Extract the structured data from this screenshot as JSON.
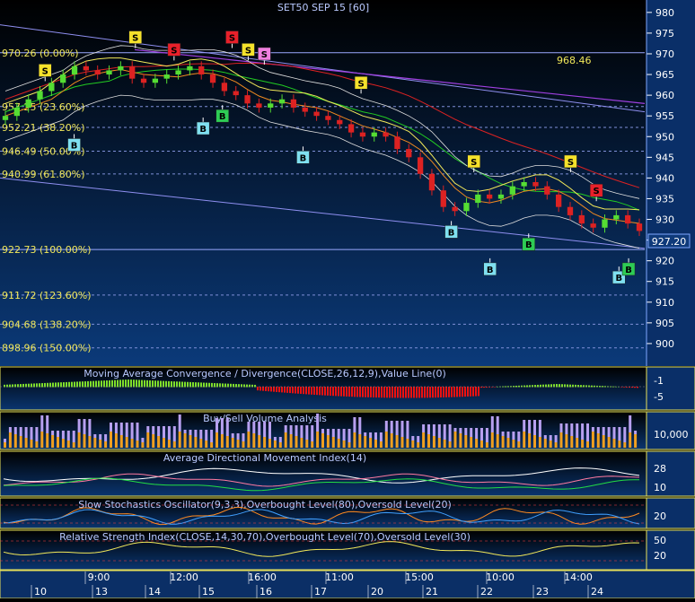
{
  "chart_data": [
    {
      "type": "candlestick",
      "title": "SET50 SEP 15   [60]",
      "y_ticks": [
        980,
        975,
        970,
        965,
        960,
        955,
        950,
        945,
        940,
        935,
        930,
        925,
        920,
        915,
        910,
        905,
        900
      ],
      "ylim": [
        895,
        983
      ],
      "last_price": "927.20",
      "annotation": "968.46",
      "close_series": [
        955,
        957,
        959,
        961,
        963,
        965,
        967,
        966,
        965,
        966,
        967,
        964,
        963,
        964,
        965,
        966,
        967,
        965,
        963,
        961,
        960,
        958,
        957,
        958,
        959,
        957,
        956,
        955,
        954,
        953,
        951,
        950,
        951,
        950,
        947,
        945,
        941,
        937,
        933,
        932,
        934,
        936,
        935,
        936,
        938,
        939,
        938,
        936,
        933,
        931,
        929,
        928,
        930,
        931,
        929,
        927.2
      ],
      "fibonacci": [
        {
          "label": "970.26 (0.00%)",
          "value": 970.26
        },
        {
          "label": "957.25 (23.60%)",
          "value": 957.25
        },
        {
          "label": "952.21 (38.20%)",
          "value": 952.21
        },
        {
          "label": "946.49 (50.00%)",
          "value": 946.49
        },
        {
          "label": "940.99 (61.80%)",
          "value": 940.99
        },
        {
          "label": "922.73 (100.00%)",
          "value": 922.73
        },
        {
          "label": "911.72 (123.60%)",
          "value": 911.72
        },
        {
          "label": "904.68 (138.20%)",
          "value": 904.68
        },
        {
          "label": "898.96 (150.00%)",
          "value": 898.96
        }
      ],
      "signals": [
        {
          "kind": "S",
          "color": "#f5e22b",
          "t": 0.07,
          "price": 966
        },
        {
          "kind": "S",
          "color": "#f5e22b",
          "t": 0.21,
          "price": 974
        },
        {
          "kind": "S",
          "color": "#e8202a",
          "t": 0.27,
          "price": 971
        },
        {
          "kind": "S",
          "color": "#e8202a",
          "t": 0.36,
          "price": 974
        },
        {
          "kind": "S",
          "color": "#f5e22b",
          "t": 0.385,
          "price": 971
        },
        {
          "kind": "S",
          "color": "#ef7fe0",
          "t": 0.41,
          "price": 970
        },
        {
          "kind": "S",
          "color": "#f5e22b",
          "t": 0.56,
          "price": 963
        },
        {
          "kind": "S",
          "color": "#f5e22b",
          "t": 0.735,
          "price": 944
        },
        {
          "kind": "S",
          "color": "#f5e22b",
          "t": 0.885,
          "price": 944
        },
        {
          "kind": "S",
          "color": "#e8202a",
          "t": 0.925,
          "price": 937
        },
        {
          "kind": "B",
          "color": "#7fe0f0",
          "t": 0.115,
          "price": 948
        },
        {
          "kind": "B",
          "color": "#7fe0f0",
          "t": 0.315,
          "price": 952
        },
        {
          "kind": "B",
          "color": "#2ecc55",
          "t": 0.345,
          "price": 955
        },
        {
          "kind": "B",
          "color": "#7fe0f0",
          "t": 0.47,
          "price": 945
        },
        {
          "kind": "B",
          "color": "#7fe0f0",
          "t": 0.7,
          "price": 927
        },
        {
          "kind": "B",
          "color": "#7fe0f0",
          "t": 0.76,
          "price": 918
        },
        {
          "kind": "B",
          "color": "#2ecc55",
          "t": 0.82,
          "price": 924
        },
        {
          "kind": "B",
          "color": "#7fe0f0",
          "t": 0.96,
          "price": 916
        },
        {
          "kind": "B",
          "color": "#2ecc55",
          "t": 0.975,
          "price": 918
        }
      ]
    },
    {
      "type": "bar",
      "title": "Moving Average Convergence / Divergence(CLOSE,26,12,9),Value Line(0)",
      "y_ticks": [
        "-1",
        "-5"
      ],
      "ylim": [
        -7,
        1
      ]
    },
    {
      "type": "bar",
      "title": "Buy/Sell Volume Analysis",
      "y_ticks": [
        "10,000"
      ]
    },
    {
      "type": "line",
      "title": "Average Directional Movement Index(14)",
      "y_ticks": [
        "28",
        "10"
      ],
      "ylim": [
        0,
        50
      ]
    },
    {
      "type": "line",
      "title": "Slow Stochastics Oscillator(9,3,3),Overbought Level(80),Oversold Level(20)",
      "y_ticks": [
        "20"
      ],
      "ylim": [
        0,
        100
      ]
    },
    {
      "type": "line",
      "title": "Relative Strength Index(CLOSE,14,30,70),Overbought Level(70),Oversold Level(30)",
      "y_ticks": [
        "50",
        "20"
      ],
      "ylim": [
        0,
        100
      ]
    }
  ],
  "x_axis": {
    "time_labels": [
      "9:00",
      "12:00",
      "16:00",
      "11:00",
      "15:00",
      "10:00",
      "14:00"
    ],
    "day_labels": [
      "10",
      "13",
      "14",
      "15",
      "16",
      "17",
      "20",
      "21",
      "22",
      "23",
      "24"
    ]
  },
  "colors": {
    "background_top": "#000000",
    "background_bottom": "#0b3a7a",
    "panel_border": "#e8e25a",
    "fib_text": "#f2e85a",
    "axis_text": "#ffffff",
    "title_text": "#b9c9ff",
    "up": "#55dd33",
    "down": "#dd2222"
  }
}
